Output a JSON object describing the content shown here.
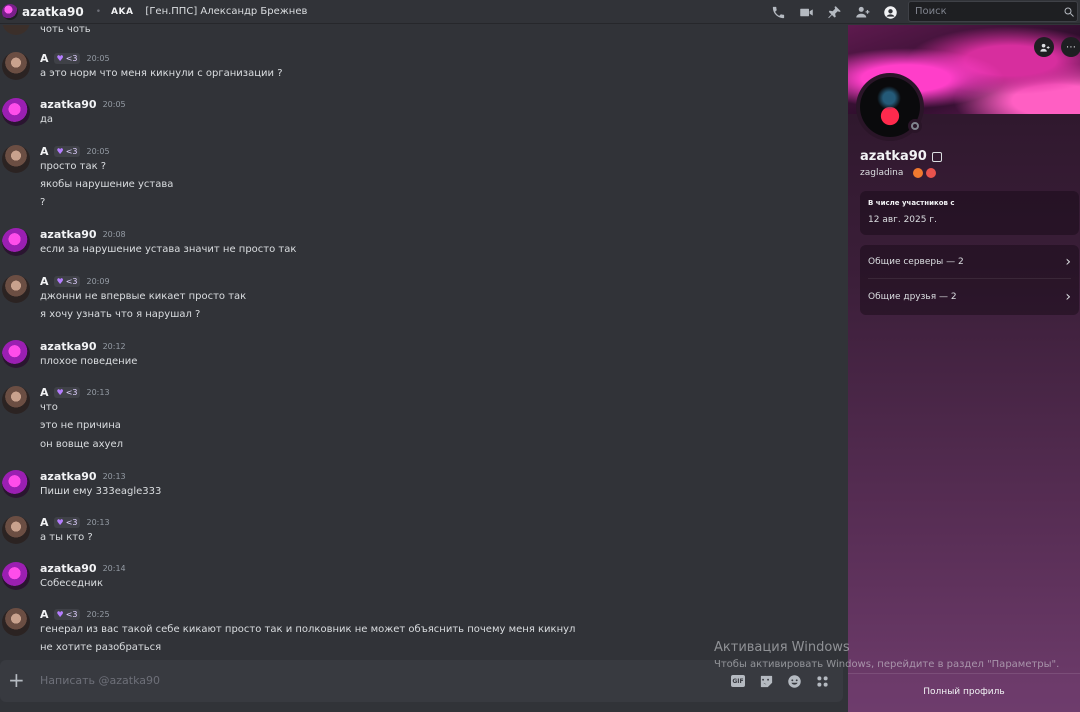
{
  "topbar": {
    "username": "azatka90",
    "clan_tag": "AKA",
    "guild_title": "[Ген.ППС] Александр Брежнев",
    "icons": [
      "phone-icon",
      "video-icon",
      "pin-icon",
      "add-friend-icon",
      "user-profile-icon"
    ],
    "search_placeholder": "Поиск"
  },
  "chat": {
    "cut_off_text": "чоть чоть",
    "messages": [
      {
        "author": "A",
        "badge": "<3",
        "time": "20:05",
        "lines": [
          "а это норм что меня кикнули с организации ?"
        ]
      },
      {
        "author": "azatka90",
        "time": "20:05",
        "lines": [
          "да"
        ]
      },
      {
        "author": "A",
        "badge": "<3",
        "time": "20:05",
        "lines": [
          "просто  так ?",
          "якобы нарушение устава",
          "?"
        ]
      },
      {
        "author": "azatka90",
        "time": "20:08",
        "lines": [
          "если за нарушение устава значит не просто так"
        ]
      },
      {
        "author": "A",
        "badge": "<3",
        "time": "20:09",
        "lines": [
          "джонни не впервые кикает просто так",
          "я хочу узнать что я нарушал ?"
        ]
      },
      {
        "author": "azatka90",
        "time": "20:12",
        "lines": [
          "плохое поведение"
        ]
      },
      {
        "author": "A",
        "badge": "<3",
        "time": "20:13",
        "lines": [
          "что",
          "это не причина",
          "он вовще ахуел"
        ]
      },
      {
        "author": "azatka90",
        "time": "20:13",
        "lines": [
          "Пиши ему 333eagle333"
        ]
      },
      {
        "author": "A",
        "badge": "<3",
        "time": "20:13",
        "lines": [
          "а ты кто ?"
        ]
      },
      {
        "author": "azatka90",
        "time": "20:14",
        "lines": [
          "Собеседник"
        ]
      },
      {
        "author": "A",
        "badge": "<3",
        "time": "20:25",
        "lines": [
          "генерал из вас такой себе кикают просто так и полковник не может объяснить почему меня кикнул",
          "не хотите разобраться"
        ]
      }
    ]
  },
  "composer": {
    "placeholder": "Написать @azatka90",
    "gif_label": "GIF",
    "icons": [
      "gif-icon",
      "sticker-icon",
      "emoji-icon",
      "apps-icon"
    ]
  },
  "profile": {
    "display_name": "azatka90",
    "handle": "zagladina",
    "member_since_label": "В числе участников с",
    "member_since_value": "12 авг. 2025 г.",
    "mutual_servers": "Общие серверы — 2",
    "mutual_friends": "Общие друзья — 2",
    "full_profile": "Полный профиль"
  },
  "watermark": {
    "title": "Активация Windows",
    "subtitle": "Чтобы активировать Windows, перейдите в раздел \"Параметры\"."
  }
}
